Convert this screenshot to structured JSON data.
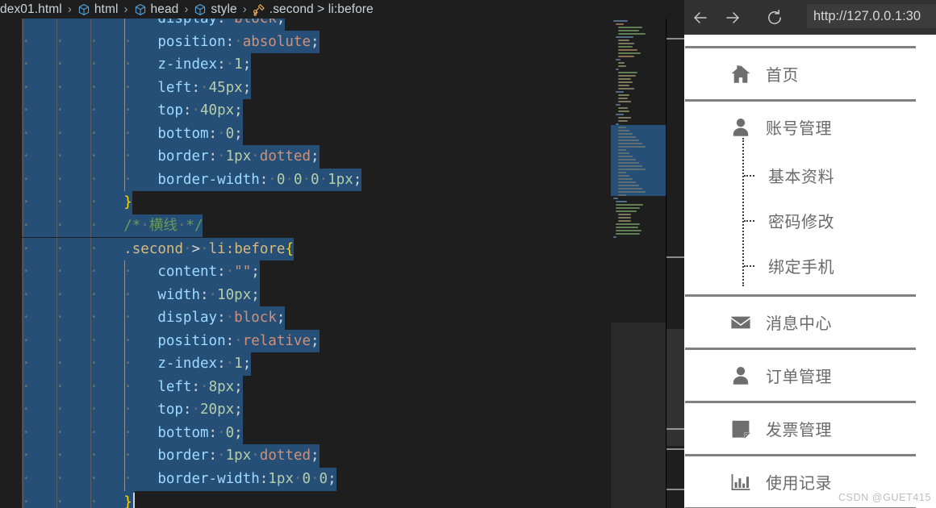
{
  "editor": {
    "breadcrumb": [
      {
        "label": "dex01.html",
        "icon": "none"
      },
      {
        "label": "html",
        "icon": "symbol-cube-icon"
      },
      {
        "label": "head",
        "icon": "symbol-cube-icon"
      },
      {
        "label": "style",
        "icon": "symbol-cube-icon"
      },
      {
        "label": ".second > li:before",
        "icon": "symbol-ruler-icon"
      }
    ],
    "breadcrumb_separator": "›",
    "colors": {
      "background": "#1e1e1e",
      "selection": "#264f78",
      "property": "#9cdcfe",
      "keyword": "#ce9178",
      "number": "#b5cea8",
      "comment": "#6a9955",
      "selector": "#d7ba7d",
      "brace": "#ffd700",
      "punctuation": "#d4d4d4"
    },
    "lines": [
      {
        "indent": 4,
        "selected": true,
        "partial_top": true,
        "tokens": [
          {
            "t": "display",
            "c": "prop"
          },
          {
            "t": ":",
            "c": "punct"
          },
          {
            "t": " ",
            "c": "ws"
          },
          {
            "t": "block",
            "c": "kw"
          },
          {
            "t": ";",
            "c": "punct"
          }
        ]
      },
      {
        "indent": 4,
        "selected": true,
        "tokens": [
          {
            "t": "position",
            "c": "prop"
          },
          {
            "t": ":",
            "c": "punct"
          },
          {
            "t": " ",
            "c": "ws"
          },
          {
            "t": "absolute",
            "c": "kw"
          },
          {
            "t": ";",
            "c": "punct"
          }
        ]
      },
      {
        "indent": 4,
        "selected": true,
        "tokens": [
          {
            "t": "z-index",
            "c": "prop"
          },
          {
            "t": ":",
            "c": "punct"
          },
          {
            "t": " ",
            "c": "ws"
          },
          {
            "t": "1",
            "c": "num"
          },
          {
            "t": ";",
            "c": "punct"
          }
        ]
      },
      {
        "indent": 4,
        "selected": true,
        "tokens": [
          {
            "t": "left",
            "c": "prop"
          },
          {
            "t": ":",
            "c": "punct"
          },
          {
            "t": " ",
            "c": "ws"
          },
          {
            "t": "45px",
            "c": "num"
          },
          {
            "t": ";",
            "c": "punct"
          }
        ]
      },
      {
        "indent": 4,
        "selected": true,
        "tokens": [
          {
            "t": "top",
            "c": "prop"
          },
          {
            "t": ":",
            "c": "punct"
          },
          {
            "t": " ",
            "c": "ws"
          },
          {
            "t": "40px",
            "c": "num"
          },
          {
            "t": ";",
            "c": "punct"
          }
        ]
      },
      {
        "indent": 4,
        "selected": true,
        "tokens": [
          {
            "t": "bottom",
            "c": "prop"
          },
          {
            "t": ":",
            "c": "punct"
          },
          {
            "t": " ",
            "c": "ws"
          },
          {
            "t": "0",
            "c": "num"
          },
          {
            "t": ";",
            "c": "punct"
          }
        ]
      },
      {
        "indent": 4,
        "selected": true,
        "tokens": [
          {
            "t": "border",
            "c": "prop"
          },
          {
            "t": ":",
            "c": "punct"
          },
          {
            "t": " ",
            "c": "ws"
          },
          {
            "t": "1px",
            "c": "num"
          },
          {
            "t": " ",
            "c": "ws"
          },
          {
            "t": "dotted",
            "c": "kw"
          },
          {
            "t": ";",
            "c": "punct"
          }
        ]
      },
      {
        "indent": 4,
        "selected": true,
        "tokens": [
          {
            "t": "border-width",
            "c": "prop"
          },
          {
            "t": ":",
            "c": "punct"
          },
          {
            "t": " ",
            "c": "ws"
          },
          {
            "t": "0",
            "c": "num"
          },
          {
            "t": " ",
            "c": "ws"
          },
          {
            "t": "0",
            "c": "num"
          },
          {
            "t": " ",
            "c": "ws"
          },
          {
            "t": "0",
            "c": "num"
          },
          {
            "t": " ",
            "c": "ws"
          },
          {
            "t": "1px",
            "c": "num"
          },
          {
            "t": ";",
            "c": "punct"
          }
        ]
      },
      {
        "indent": 3,
        "selected": true,
        "tokens": [
          {
            "t": "}",
            "c": "brace"
          }
        ]
      },
      {
        "indent": 3,
        "selected": true,
        "tokens": [
          {
            "t": "/*",
            "c": "comment"
          },
          {
            "t": " ",
            "c": "ws"
          },
          {
            "t": "横线",
            "c": "comment"
          },
          {
            "t": " ",
            "c": "ws"
          },
          {
            "t": "*/",
            "c": "comment"
          }
        ]
      },
      {
        "indent": 3,
        "selected": true,
        "tokens": [
          {
            "t": ".second",
            "c": "sel"
          },
          {
            "t": " ",
            "c": "ws"
          },
          {
            "t": ">",
            "c": "punct"
          },
          {
            "t": " ",
            "c": "ws"
          },
          {
            "t": "li:before",
            "c": "sel"
          },
          {
            "t": "{",
            "c": "brace"
          }
        ]
      },
      {
        "indent": 4,
        "selected": true,
        "tokens": [
          {
            "t": "content",
            "c": "prop"
          },
          {
            "t": ":",
            "c": "punct"
          },
          {
            "t": " ",
            "c": "ws"
          },
          {
            "t": "\"\"",
            "c": "str"
          },
          {
            "t": ";",
            "c": "punct"
          }
        ]
      },
      {
        "indent": 4,
        "selected": true,
        "tokens": [
          {
            "t": "width",
            "c": "prop"
          },
          {
            "t": ":",
            "c": "punct"
          },
          {
            "t": " ",
            "c": "ws"
          },
          {
            "t": "10px",
            "c": "num"
          },
          {
            "t": ";",
            "c": "punct"
          }
        ]
      },
      {
        "indent": 4,
        "selected": true,
        "tokens": [
          {
            "t": "display",
            "c": "prop"
          },
          {
            "t": ":",
            "c": "punct"
          },
          {
            "t": " ",
            "c": "ws"
          },
          {
            "t": "block",
            "c": "kw"
          },
          {
            "t": ";",
            "c": "punct"
          }
        ]
      },
      {
        "indent": 4,
        "selected": true,
        "tokens": [
          {
            "t": "position",
            "c": "prop"
          },
          {
            "t": ":",
            "c": "punct"
          },
          {
            "t": " ",
            "c": "ws"
          },
          {
            "t": "relative",
            "c": "kw"
          },
          {
            "t": ";",
            "c": "punct"
          }
        ]
      },
      {
        "indent": 4,
        "selected": true,
        "tokens": [
          {
            "t": "z-index",
            "c": "prop"
          },
          {
            "t": ":",
            "c": "punct"
          },
          {
            "t": " ",
            "c": "ws"
          },
          {
            "t": "1",
            "c": "num"
          },
          {
            "t": ";",
            "c": "punct"
          }
        ]
      },
      {
        "indent": 4,
        "selected": true,
        "tokens": [
          {
            "t": "left",
            "c": "prop"
          },
          {
            "t": ":",
            "c": "punct"
          },
          {
            "t": " ",
            "c": "ws"
          },
          {
            "t": "8px",
            "c": "num"
          },
          {
            "t": ";",
            "c": "punct"
          }
        ]
      },
      {
        "indent": 4,
        "selected": true,
        "tokens": [
          {
            "t": "top",
            "c": "prop"
          },
          {
            "t": ":",
            "c": "punct"
          },
          {
            "t": " ",
            "c": "ws"
          },
          {
            "t": "20px",
            "c": "num"
          },
          {
            "t": ";",
            "c": "punct"
          }
        ]
      },
      {
        "indent": 4,
        "selected": true,
        "tokens": [
          {
            "t": "bottom",
            "c": "prop"
          },
          {
            "t": ":",
            "c": "punct"
          },
          {
            "t": " ",
            "c": "ws"
          },
          {
            "t": "0",
            "c": "num"
          },
          {
            "t": ";",
            "c": "punct"
          }
        ]
      },
      {
        "indent": 4,
        "selected": true,
        "tokens": [
          {
            "t": "border",
            "c": "prop"
          },
          {
            "t": ":",
            "c": "punct"
          },
          {
            "t": " ",
            "c": "ws"
          },
          {
            "t": "1px",
            "c": "num"
          },
          {
            "t": " ",
            "c": "ws"
          },
          {
            "t": "dotted",
            "c": "kw"
          },
          {
            "t": ";",
            "c": "punct"
          }
        ]
      },
      {
        "indent": 4,
        "selected": true,
        "tokens": [
          {
            "t": "border-width",
            "c": "prop"
          },
          {
            "t": ":",
            "c": "punct"
          },
          {
            "t": "1px",
            "c": "num"
          },
          {
            "t": " ",
            "c": "ws"
          },
          {
            "t": "0",
            "c": "num"
          },
          {
            "t": " ",
            "c": "ws"
          },
          {
            "t": "0",
            "c": "num"
          },
          {
            "t": ";",
            "c": "punct"
          }
        ]
      },
      {
        "indent": 3,
        "selected": true,
        "cursor": true,
        "tokens": [
          {
            "t": "}",
            "c": "brace"
          }
        ]
      }
    ]
  },
  "browser": {
    "toolbar": {
      "back_label": "back-arrow",
      "forward_label": "forward-arrow",
      "reload_label": "reload",
      "url": "http://127.0.0.1:30"
    },
    "menu": [
      {
        "icon": "home-icon",
        "label": "首页",
        "children": []
      },
      {
        "icon": "user-icon",
        "label": "账号管理",
        "children": [
          "基本资料",
          "密码修改",
          "绑定手机"
        ]
      },
      {
        "icon": "envelope-icon",
        "label": "消息中心",
        "children": []
      },
      {
        "icon": "user-icon",
        "label": "订单管理",
        "children": []
      },
      {
        "icon": "document-icon",
        "label": "发票管理",
        "children": []
      },
      {
        "icon": "bar-chart-icon",
        "label": "使用记录",
        "children": []
      }
    ],
    "watermark": "CSDN @GUET415"
  }
}
